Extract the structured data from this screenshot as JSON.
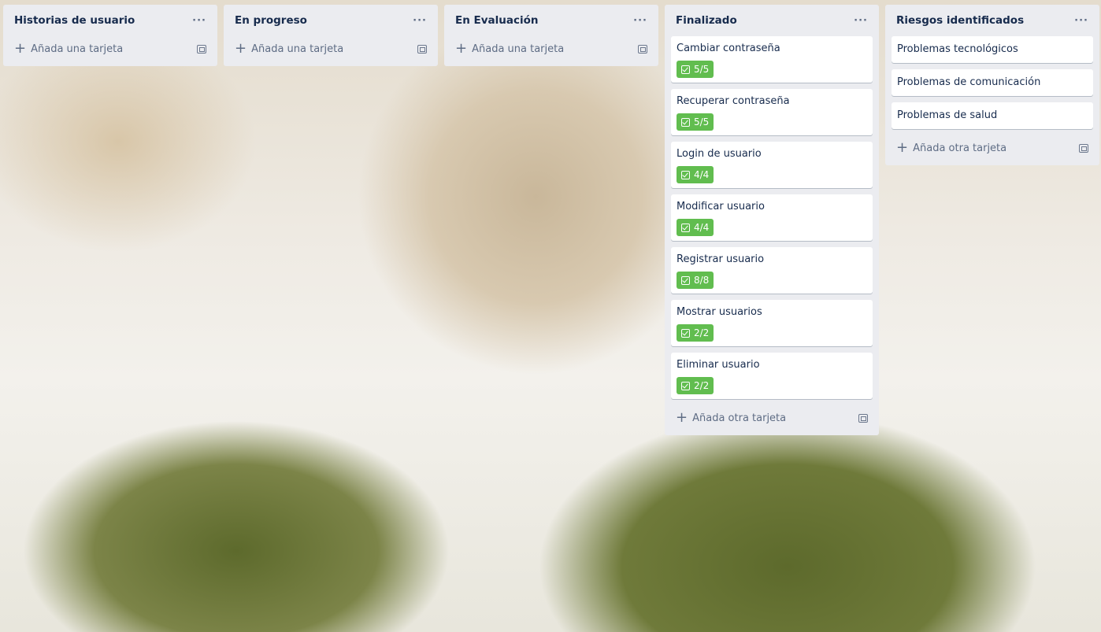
{
  "lists": [
    {
      "title": "Historias de usuario",
      "cards": [],
      "add_label": "Añada una tarjeta"
    },
    {
      "title": "En progreso",
      "cards": [],
      "add_label": "Añada una tarjeta"
    },
    {
      "title": "En Evaluación",
      "cards": [],
      "add_label": "Añada una tarjeta"
    },
    {
      "title": "Finalizado",
      "add_label": "Añada otra tarjeta",
      "cards": [
        {
          "title": "Cambiar contraseña",
          "checklist": "5/5"
        },
        {
          "title": "Recuperar contraseña",
          "checklist": "5/5"
        },
        {
          "title": "Login de usuario",
          "checklist": "4/4"
        },
        {
          "title": "Modificar usuario",
          "checklist": "4/4"
        },
        {
          "title": "Registrar usuario",
          "checklist": "8/8"
        },
        {
          "title": "Mostrar usuarios",
          "checklist": "2/2"
        },
        {
          "title": "Eliminar usuario",
          "checklist": "2/2"
        }
      ]
    },
    {
      "title": "Riesgos identificados",
      "add_label": "Añada otra tarjeta",
      "cards": [
        {
          "title": "Problemas tecnológicos"
        },
        {
          "title": "Problemas de comunicación"
        },
        {
          "title": "Problemas de salud"
        }
      ]
    }
  ],
  "menu_label": "···",
  "colors": {
    "badge": "#61bd4f",
    "list_bg": "#ebecf0"
  }
}
